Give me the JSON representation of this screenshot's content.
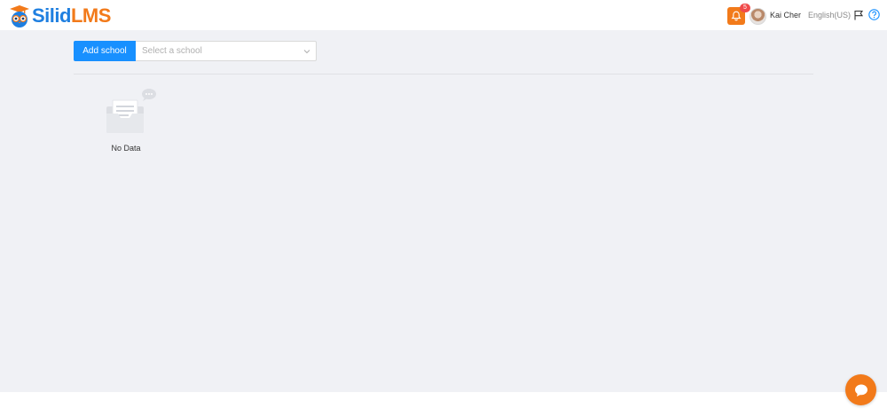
{
  "brand": {
    "logo_part1": "Silid",
    "logo_part2": "LMS",
    "primary_color": "#1f7fe0",
    "accent_color": "#f27a1a"
  },
  "header": {
    "notification_count": "5",
    "notification_icon": "bell-icon",
    "user_name": "Kai Cher",
    "language": "English(US)",
    "flag_icon": "flag-icon",
    "help_icon": "question-circle-icon"
  },
  "toolbar": {
    "add_school_label": "Add school",
    "school_select": {
      "placeholder": "Select a school"
    }
  },
  "empty_state": {
    "text": "No Data"
  },
  "chat": {
    "icon": "chat-bubble-icon"
  }
}
